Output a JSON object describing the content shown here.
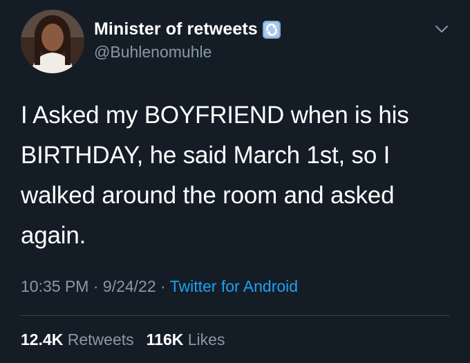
{
  "tweet": {
    "author": {
      "display_name": "Minister of retweets",
      "badge_icon": "repeat-arrows-emoji-icon",
      "handle": "@Buhlenomuhle"
    },
    "text": "I Asked my BOYFRIEND when is his BIRTHDAY, he said March 1st, so I walked around the room and asked again.",
    "time": "10:35 PM",
    "separator": "·",
    "date": "9/24/22",
    "source": "Twitter for Android",
    "stats": {
      "retweets_count": "12.4K",
      "retweets_label": "Retweets",
      "likes_count": "116K",
      "likes_label": "Likes"
    }
  },
  "colors": {
    "background": "#141d26",
    "primary_text": "#ffffff",
    "secondary_text": "#8899a6",
    "link": "#1da1f2",
    "divider": "#38444d"
  }
}
